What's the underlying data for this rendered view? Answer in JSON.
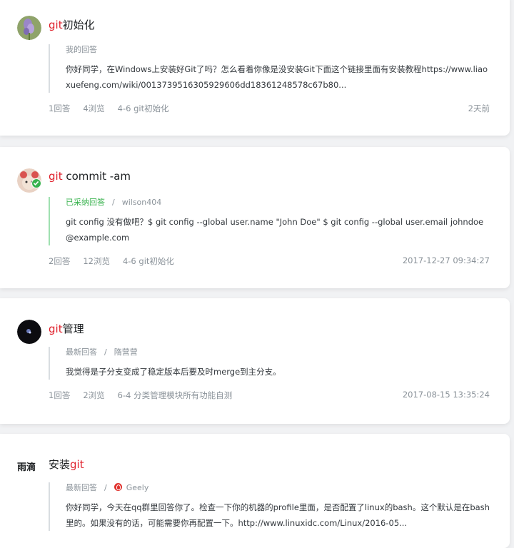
{
  "cards": [
    {
      "title_highlight": "git",
      "title_rest": "初始化",
      "meta_label": "我的回答",
      "body": "你好同学，在Windows上安装好Git了吗？怎么看着你像是没安装Git下面这个链接里面有安装教程https://www.liaoxuefeng.com/wiki/0013739516305929606dd18361248578c67b80...",
      "answers": "1回答",
      "views": "4浏览",
      "course": "4-6 git初始化",
      "time": "2天前"
    },
    {
      "title_highlight": "git",
      "title_rest": " commit -am",
      "meta_label": "已采纳回答",
      "meta_sep": "/",
      "meta_user": "wilson404",
      "body": "git config 没有做吧？$ git config --global user.name \"John Doe\" $ git config --global user.email johndoe@example.com",
      "answers": "2回答",
      "views": "12浏览",
      "course": "4-6 git初始化",
      "time": "2017-12-27 09:34:27"
    },
    {
      "title_highlight": "git",
      "title_rest": "管理",
      "meta_label": "最新回答",
      "meta_sep": "/",
      "meta_user": "隋营营",
      "body": "我觉得是子分支变成了稳定版本后要及时merge到主分支。",
      "answers": "1回答",
      "views": "2浏览",
      "course": "6-4 分类管理模块所有功能自测",
      "time": "2017-08-15 13:35:24"
    },
    {
      "avatar_text": "雨滴",
      "title_prefix": "安装",
      "title_highlight": "git",
      "meta_label": "最新回答",
      "meta_sep": "/",
      "meta_user": "Geely",
      "body": "你好同学，今天在qq群里回答你了。检查一下你的机器的profile里面，是否配置了linux的bash。这个默认是在bash里的。如果没有的话，可能需要你再配置一下。http://www.linuxidc.com/Linux/2016-05..."
    }
  ]
}
